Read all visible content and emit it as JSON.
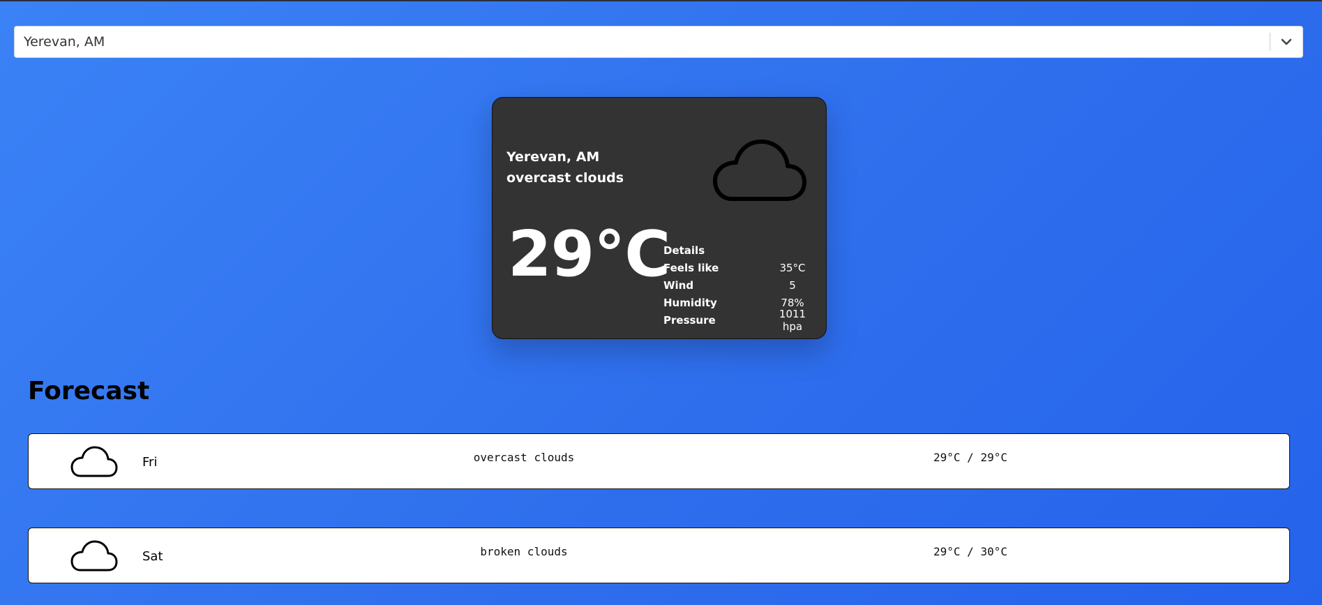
{
  "search": {
    "selected_value": "Yerevan, AM",
    "dropdown_icon": "chevron-down-icon"
  },
  "current": {
    "city": "Yerevan, AM",
    "description": "overcast clouds",
    "icon": "cloud-icon",
    "temperature": "29°C",
    "details_heading": "Details",
    "details": [
      {
        "label": "Feels like",
        "value": "35°C"
      },
      {
        "label": "Wind",
        "value": "5"
      },
      {
        "label": "Humidity",
        "value": "78%"
      },
      {
        "label": "Pressure",
        "value": "1011 hpa"
      }
    ]
  },
  "forecast": {
    "title": "Forecast",
    "items": [
      {
        "day": "Fri",
        "description": "overcast clouds",
        "temps": "29°C / 29°C",
        "icon": "cloud-icon"
      },
      {
        "day": "Sat",
        "description": "broken clouds",
        "temps": "29°C / 30°C",
        "icon": "cloud-icon"
      }
    ]
  },
  "colors": {
    "background": "#2f6fed",
    "card": "#333333",
    "row": "#ffffff"
  }
}
